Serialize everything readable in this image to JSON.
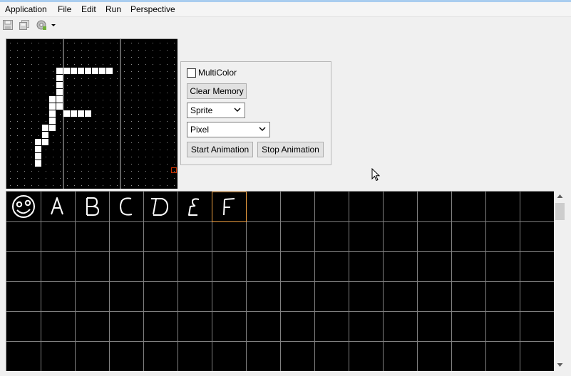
{
  "menubar": {
    "items": [
      "Application",
      "File",
      "Edit",
      "Run",
      "Perspective"
    ]
  },
  "toolbar": {
    "icons": [
      "save-icon",
      "save-all-icon",
      "run-icon",
      "dropdown-arrow-icon"
    ]
  },
  "controls": {
    "multicolor_label": "MultiColor",
    "multicolor_checked": false,
    "clear_memory_label": "Clear Memory",
    "mode_select_value": "Sprite",
    "draw_select_value": "Pixel",
    "start_animation_label": "Start Animation",
    "stop_animation_label": "Stop Animation"
  },
  "editor": {
    "pixel_color": "#ffffff",
    "background": "#000000",
    "divider_color": "#c0c0c0",
    "marker_color": "#cc3300"
  },
  "charset": {
    "cells": [
      "smiley-face",
      "A",
      "B",
      "C",
      "D",
      "E",
      "F"
    ],
    "selected_index": 6,
    "selected_border_color": "#f0a040",
    "grid_line_color": "#808080"
  }
}
